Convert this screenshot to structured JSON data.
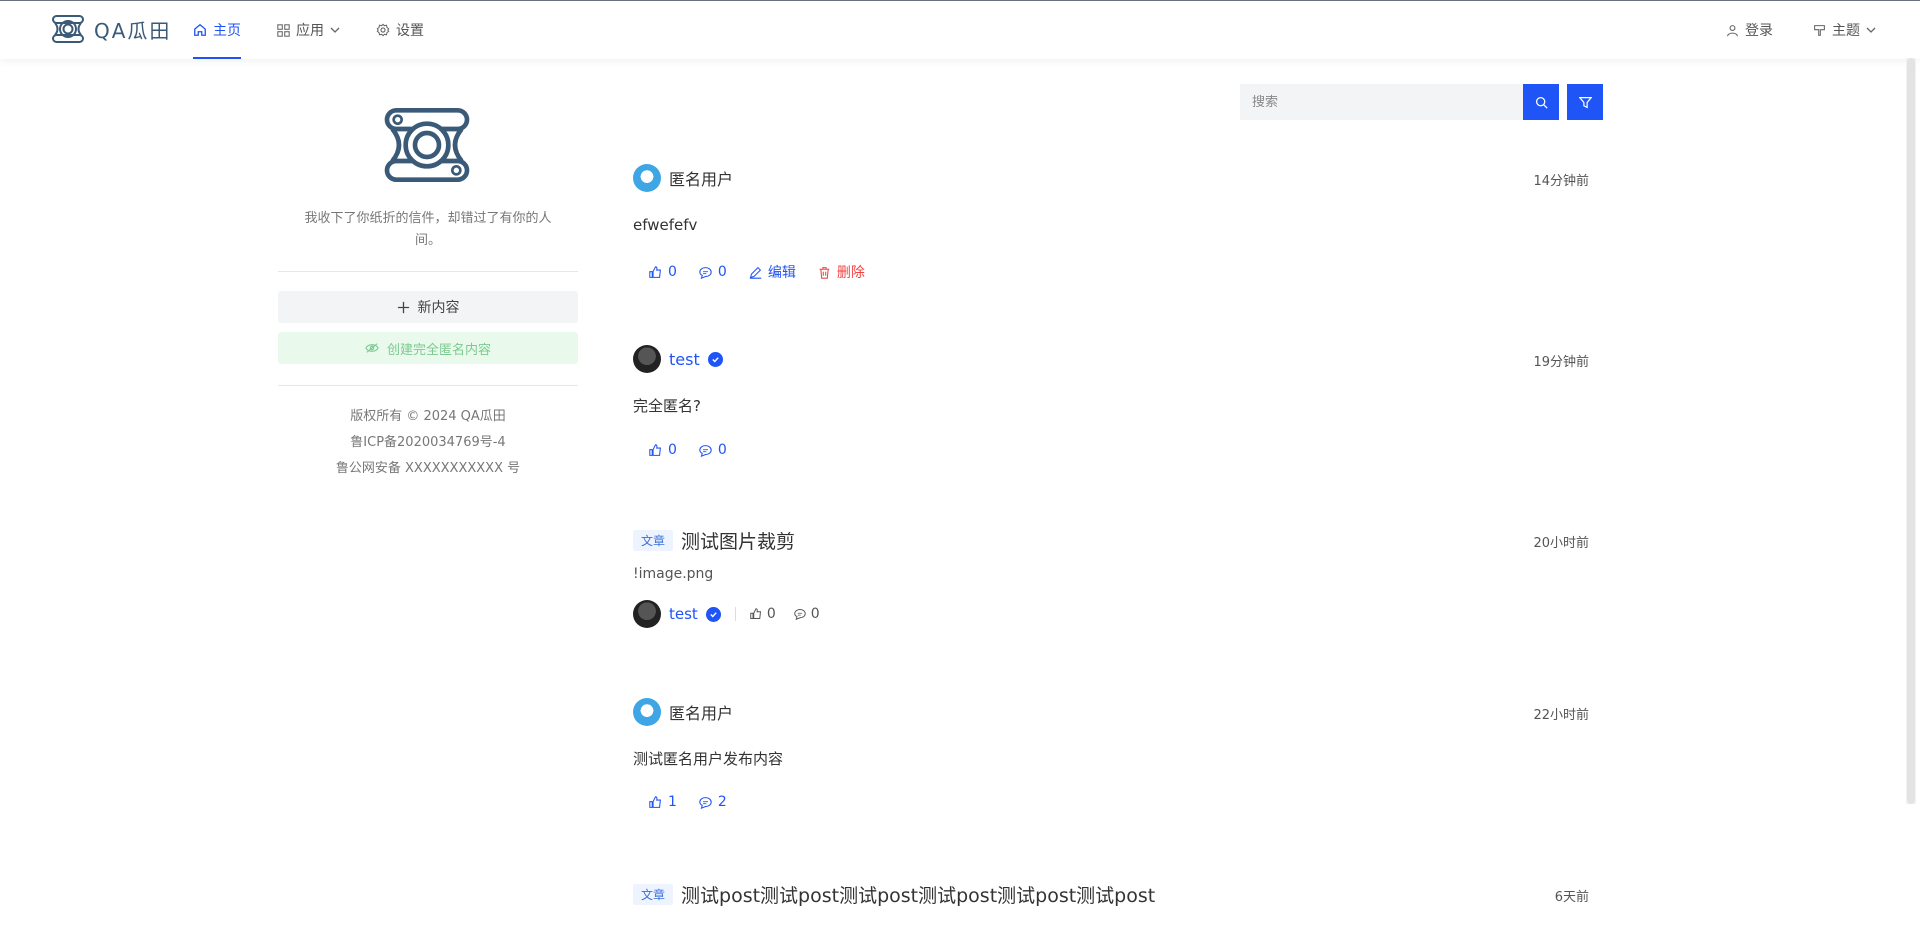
{
  "header": {
    "logo_text": "QA瓜田",
    "nav": [
      {
        "label": "主页",
        "active": true
      },
      {
        "label": "应用"
      },
      {
        "label": "设置"
      }
    ],
    "login_label": "登录",
    "theme_label": "主题"
  },
  "sidebar": {
    "slogan": "我收下了你纸折的信件，却错过了有你的人间。",
    "new_button": "新内容",
    "anon_button": "创建完全匿名内容",
    "footer": {
      "copyright": "版权所有 © 2024 QA瓜田",
      "icp": "鲁ICP备2020034769号-4",
      "police": "鲁公网安备 XXXXXXXXXXX 号"
    }
  },
  "search": {
    "placeholder": "搜索"
  },
  "posts": [
    {
      "type": "status",
      "author": "匿名用户",
      "time": "14分钟前",
      "body": "efwefefv",
      "likes": "0",
      "comments": "0",
      "edit_label": "编辑",
      "delete_label": "删除"
    },
    {
      "type": "status",
      "author": "test",
      "time": "19分钟前",
      "body": "完全匿名?",
      "likes": "0",
      "comments": "0"
    },
    {
      "type": "article",
      "tag": "文章",
      "title": "测试图片裁剪",
      "time": "20小时前",
      "excerpt": "!image.png",
      "author": "test",
      "likes": "0",
      "comments": "0"
    },
    {
      "type": "status",
      "author": "匿名用户",
      "time": "22小时前",
      "body": "测试匿名用户发布内容",
      "likes": "1",
      "comments": "2"
    },
    {
      "type": "article",
      "tag": "文章",
      "title": "测试post测试post测试post测试post测试post测试post",
      "time": "6天前"
    }
  ],
  "colors": {
    "accent": "#1f54f6",
    "danger": "#ef4444",
    "success_bg": "#e9faed",
    "success_text": "#7cc990"
  }
}
